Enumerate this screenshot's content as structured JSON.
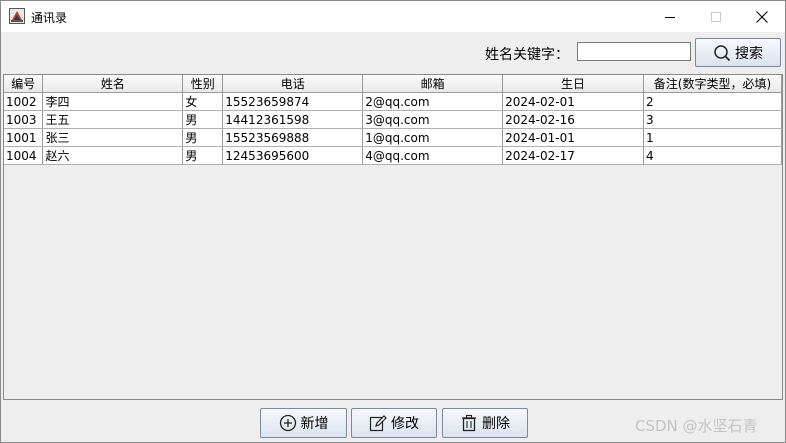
{
  "window": {
    "title": "通讯录"
  },
  "search": {
    "label": "姓名关键字：",
    "value": "",
    "button_label": "搜索"
  },
  "table": {
    "columns": [
      "编号",
      "姓名",
      "性别",
      "电话",
      "邮箱",
      "生日",
      "备注(数字类型，必填)"
    ],
    "rows": [
      [
        "1002",
        "李四",
        "女",
        "15523659874",
        "2@qq.com",
        "2024-02-01",
        "2"
      ],
      [
        "1003",
        "王五",
        "男",
        "14412361598",
        "3@qq.com",
        "2024-02-16",
        "3"
      ],
      [
        "1001",
        "张三",
        "男",
        "15523569888",
        "1@qq.com",
        "2024-01-01",
        "1"
      ],
      [
        "1004",
        "赵六",
        "男",
        "12453695600",
        "4@qq.com",
        "2024-02-17",
        "4"
      ]
    ]
  },
  "actions": {
    "add_label": "新增",
    "edit_label": "修改",
    "delete_label": "删除"
  },
  "watermark": "CSDN @水坚石青"
}
